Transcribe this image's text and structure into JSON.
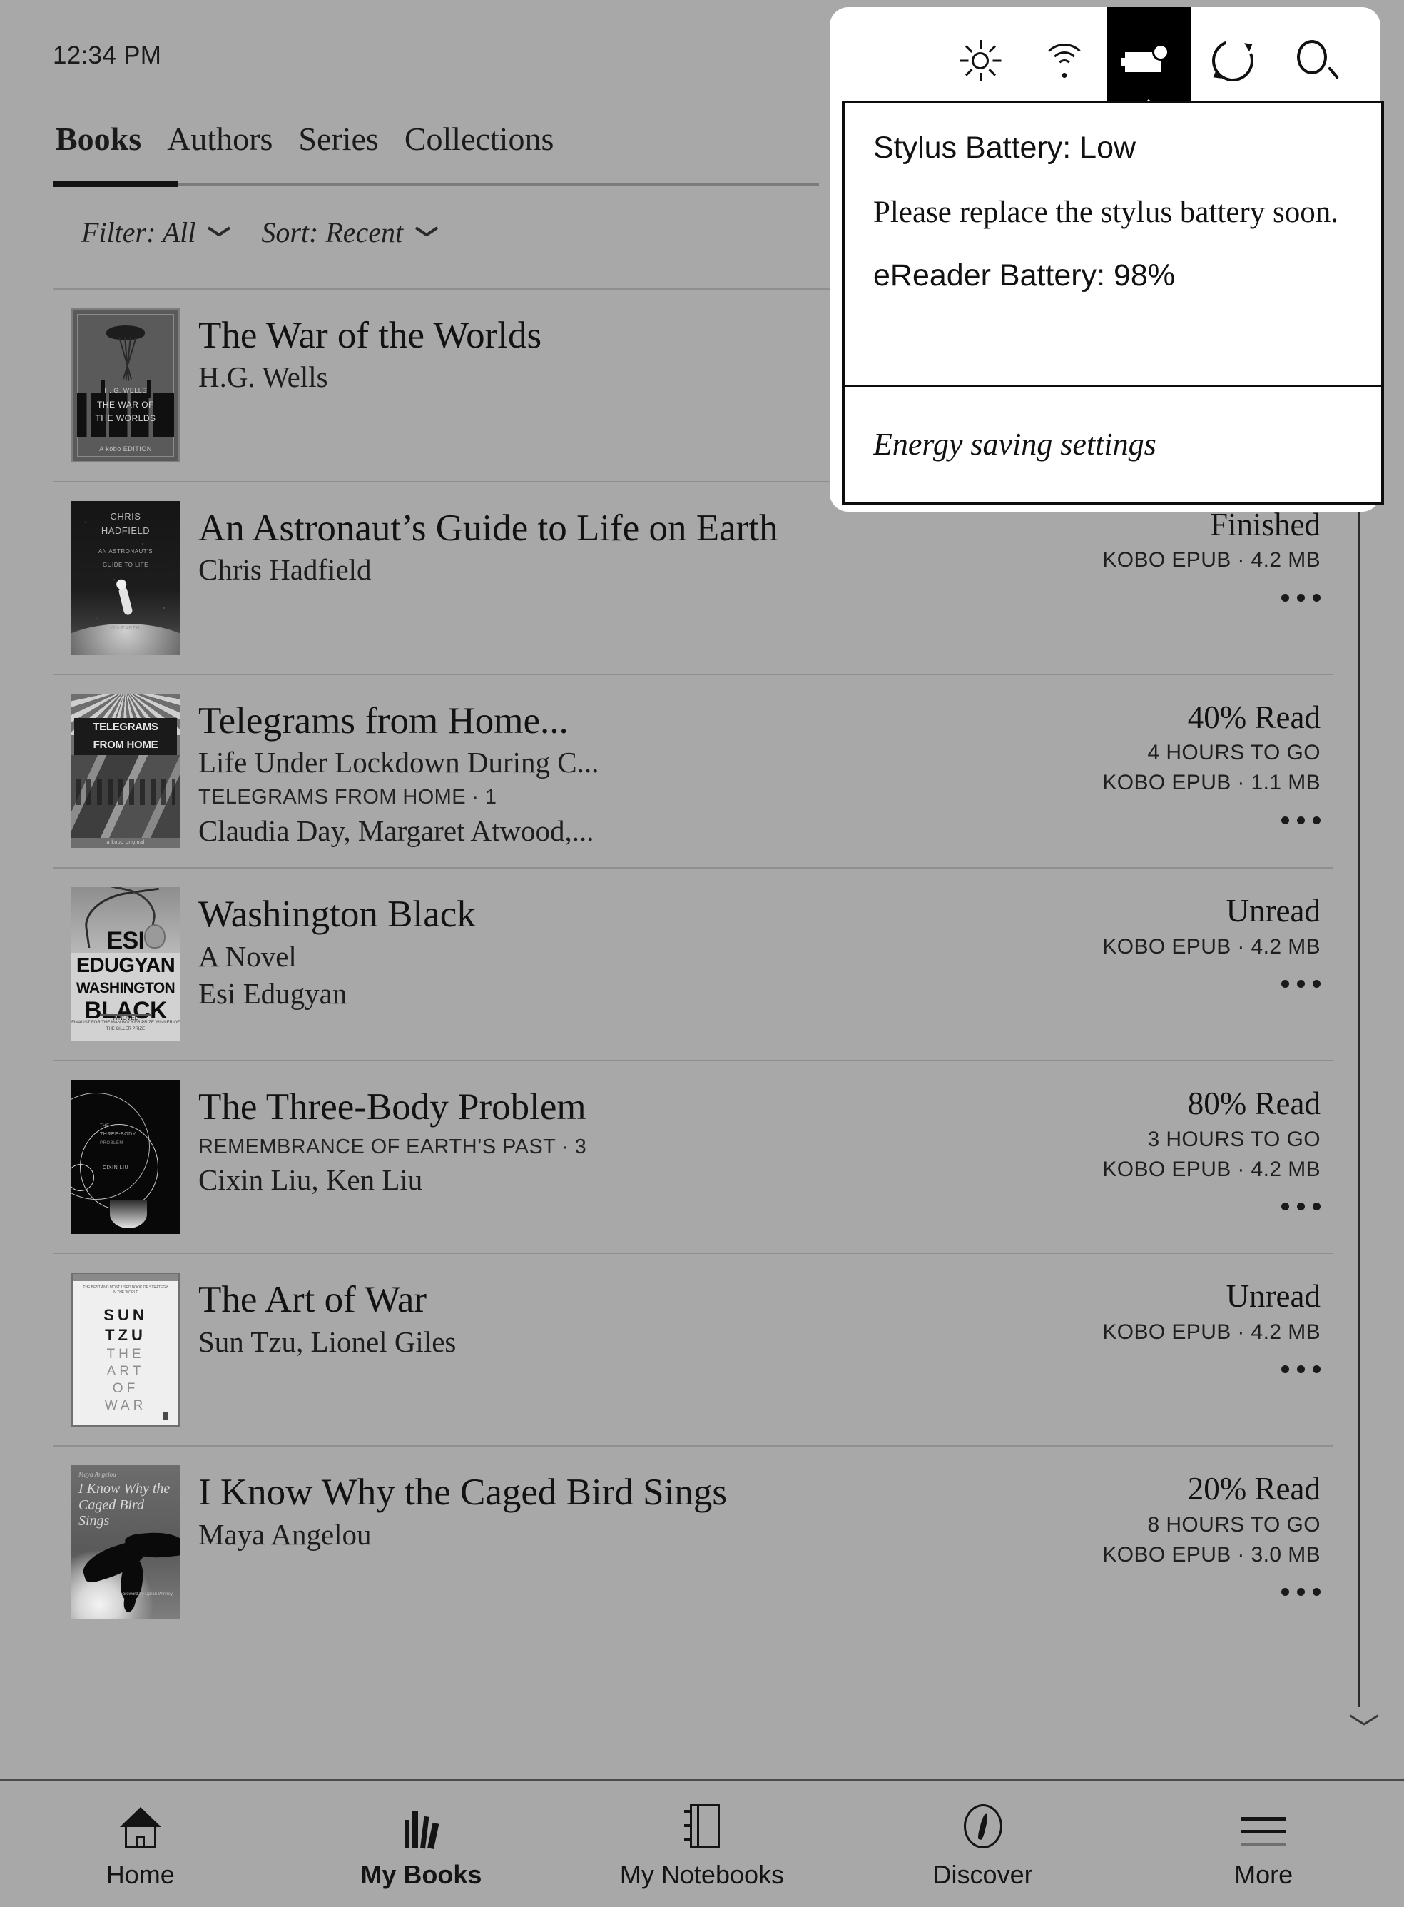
{
  "status_bar": {
    "time": "12:34 PM"
  },
  "tabs": [
    {
      "label": "Books",
      "active": true
    },
    {
      "label": "Authors",
      "active": false
    },
    {
      "label": "Series",
      "active": false
    },
    {
      "label": "Collections",
      "active": false
    }
  ],
  "controls": {
    "filter": {
      "label": "Filter: All",
      "chevron": "chevron-down-icon"
    },
    "sort": {
      "label": "Sort: Recent",
      "chevron": "chevron-down-icon"
    }
  },
  "toolbar": {
    "icons": [
      {
        "name": "brightness-icon",
        "active": false
      },
      {
        "name": "wifi-icon",
        "active": false
      },
      {
        "name": "battery-icon",
        "active": true
      },
      {
        "name": "sync-icon",
        "active": false
      },
      {
        "name": "search-icon",
        "active": false
      }
    ]
  },
  "battery_popup": {
    "stylus_status": "Stylus Battery: Low",
    "stylus_message": "Please replace the stylus battery soon.",
    "ereader_status": "eReader Battery: 98%",
    "action_label": "Energy saving settings"
  },
  "books": [
    {
      "title": "The War of the Worlds",
      "subtitle": "",
      "series": "",
      "author": "H.G. Wells",
      "status": "",
      "time_to_go": "",
      "format": "",
      "cover_style": "wotw",
      "cover_text": {
        "author": "H. G. WELLS",
        "line1": "THE WAR OF",
        "line2": "THE WORLDS",
        "imprint": "A kobo EDITION"
      }
    },
    {
      "title": "An Astronaut’s Guide to Life on Earth",
      "subtitle": "",
      "series": "",
      "author": "Chris Hadfield",
      "status": "Finished",
      "time_to_go": "",
      "format": "KOBO EPUB · 4.2 MB",
      "cover_style": "astro",
      "cover_text": {
        "l1": "CHRIS",
        "l2": "HADFIELD",
        "l3": "AN ASTRONAUT'S",
        "l4": "GUIDE TO LIFE",
        "l5": "ON EARTH"
      }
    },
    {
      "title": "Telegrams from Home...",
      "subtitle": "Life Under Lockdown During C...",
      "series": "TELEGRAMS FROM HOME · 1",
      "author": "Claudia Day, Margaret Atwood,...",
      "status": "40% Read",
      "time_to_go": "4 HOURS TO GO",
      "format": "KOBO EPUB · 1.1 MB",
      "cover_style": "tele",
      "cover_text": {
        "l1": "TELEGRAMS",
        "l2": "FROM HOME",
        "foot": "a kobo original"
      }
    },
    {
      "title": "Washington Black",
      "subtitle": "A Novel",
      "series": "",
      "author": "Esi Edugyan",
      "status": "Unread",
      "time_to_go": "",
      "format": "KOBO EPUB · 4.2 MB",
      "cover_style": "wb",
      "cover_text": {
        "n1": "ESI",
        "n2": "EDUGYAN",
        "n3": "WASHINGTON",
        "n4": "BLACK",
        "anovel": "A NOVEL",
        "blurb": "FINALIST FOR THE MAN BOOKER PRIZE\nWINNER OF THE GILLER PRIZE"
      }
    },
    {
      "title": "The Three-Body Problem",
      "subtitle": "",
      "series": "REMEMBRANCE OF EARTH’S PAST · 3",
      "author": "Cixin Liu, Ken Liu",
      "status": "80% Read",
      "time_to_go": "3 HOURS TO GO",
      "format": "KOBO EPUB · 4.2 MB",
      "cover_style": "threebody",
      "cover_text": {
        "t1": "THE",
        "t2": "THREE-BODY",
        "t3": "PROBLEM",
        "t4": "CIXIN LIU"
      }
    },
    {
      "title": "The Art of War",
      "subtitle": "",
      "series": "",
      "author": "Sun Tzu, Lionel Giles",
      "status": "Unread",
      "time_to_go": "",
      "format": "KOBO EPUB · 4.2 MB",
      "cover_style": "aow",
      "cover_text": {
        "blurb": "THE BEST AND MOST USED BOOK OF STRATEGY IN THE WORLD",
        "s1": "SUN",
        "s2": "TZU",
        "s3": "THE",
        "s4": "ART",
        "s5": "OF",
        "s6": "WAR"
      }
    },
    {
      "title": "I Know Why the Caged Bird Sings",
      "subtitle": "",
      "series": "",
      "author": "Maya Angelou",
      "status": "20% Read",
      "time_to_go": "8 HOURS TO GO",
      "format": "KOBO EPUB · 3.0 MB",
      "cover_style": "cagedbird",
      "cover_text": {
        "author": "Maya Angelou",
        "title": "I Know Why the Caged Bird Sings",
        "foreword": "Foreword by\nOprah Winfrey"
      }
    }
  ],
  "row_menu_label": "more-options",
  "scrollbar": {
    "down_label": "scroll-down"
  },
  "bottom_nav": [
    {
      "label": "Home",
      "icon": "home-icon",
      "active": false
    },
    {
      "label": "My Books",
      "icon": "books-icon",
      "active": true
    },
    {
      "label": "My Notebooks",
      "icon": "notebook-icon",
      "active": false
    },
    {
      "label": "Discover",
      "icon": "compass-icon",
      "active": false
    },
    {
      "label": "More",
      "icon": "menu-icon",
      "active": false
    }
  ],
  "colors": {
    "background": "#a8a8a8",
    "ink": "#111111",
    "panel": "#ffffff",
    "divider": "#8f8f8f"
  }
}
